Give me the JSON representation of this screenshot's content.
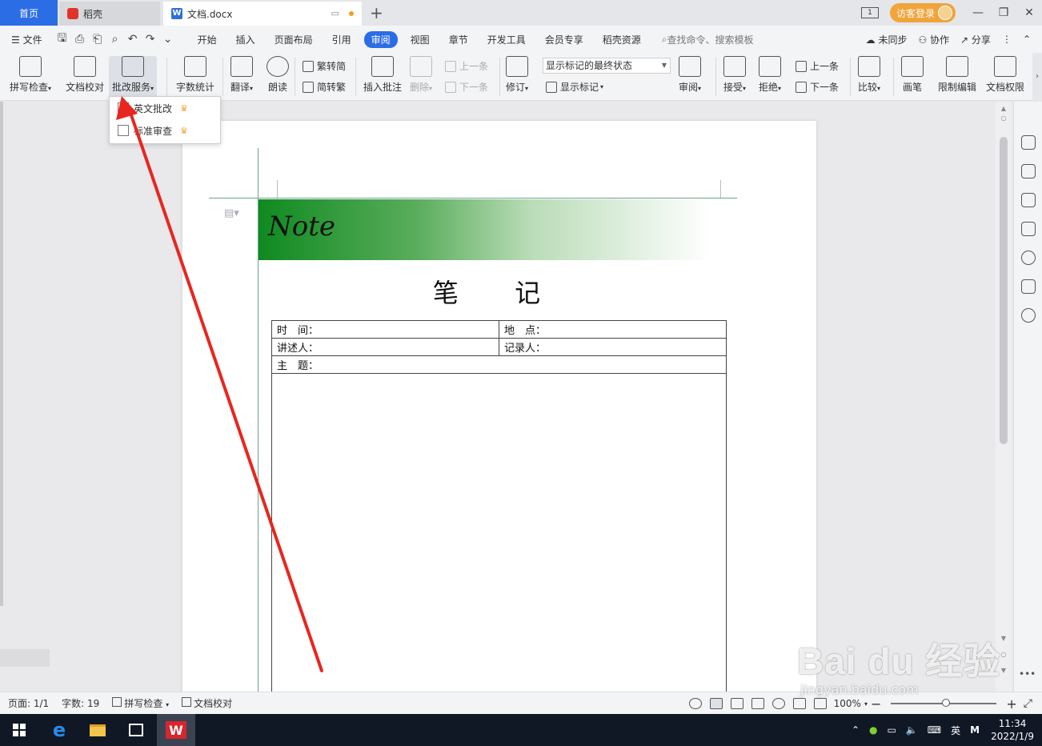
{
  "tabs": {
    "home": "首页",
    "daoke": "稻壳",
    "doc": "文档.docx",
    "new_tab": "+",
    "login": "访客登录",
    "page_count_badge": "1"
  },
  "menu": {
    "file": "文件",
    "tabs": [
      "开始",
      "插入",
      "页面布局",
      "引用",
      "审阅",
      "视图",
      "章节",
      "开发工具",
      "会员专享",
      "稻壳资源"
    ],
    "active_tab": "审阅",
    "search": "查找命令、搜索模板",
    "sync": "未同步",
    "collab": "协作",
    "share": "分享"
  },
  "ribbon": {
    "spell": "拼写检查",
    "proof": "文档校对",
    "review_service": "批改服务",
    "word_count": "字数统计",
    "translate": "翻译",
    "read_aloud": "朗读",
    "trad_to_simp": "繁转简",
    "simp_to_trad": "简转繁",
    "insert_comment": "插入批注",
    "delete": "删除",
    "prev": "上一条",
    "next": "下一条",
    "revise": "修订",
    "markup_state": "显示标记的最终状态",
    "show_markup": "显示标记",
    "review": "审阅",
    "accept": "接受",
    "reject": "拒绝",
    "prev2": "上一条",
    "next2": "下一条",
    "compare": "比较",
    "pen": "画笔",
    "restrict_edit": "限制编辑",
    "doc_permission": "文档权限"
  },
  "dropdown": {
    "items": [
      "英文批改",
      "标准审查"
    ]
  },
  "document": {
    "banner": "Note",
    "title": "笔 记",
    "time_label": "时　间：",
    "place_label": "地　点：",
    "speaker_label": "讲述人：",
    "recorder_label": "记录人：",
    "topic_label": "主　题："
  },
  "status": {
    "page": "页面: 1/1",
    "words": "字数: 19",
    "spell": "拼写检查",
    "proof": "文档校对",
    "zoom": "100%"
  },
  "taskbar": {
    "ime": "英",
    "time": "11:34",
    "date": "2022/1/9"
  },
  "watermark": {
    "brand": "Bai du 经验",
    "url": "jingyan.baidu.com"
  },
  "colors": {
    "accent": "#2b6de5",
    "login": "#f0a43a",
    "arrow": "#e8261f",
    "banner_green": "#0f8a20"
  }
}
